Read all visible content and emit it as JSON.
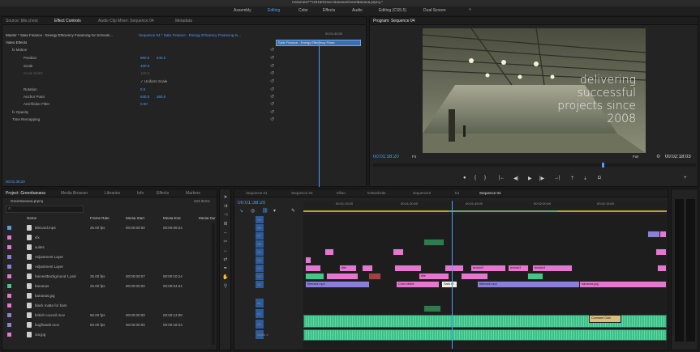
{
  "window": {
    "title": "/Volumes/***/2015/Green Banana/GreenBanana.prproj *"
  },
  "workspaces": [
    "Assembly",
    "Editing",
    "Color",
    "Effects",
    "Audio",
    "Editing (CS5.5)",
    "Dual Screen"
  ],
  "workspace_more": "»",
  "top_left_panel": {
    "tabs": [
      "Source: title.chest",
      "Effect Controls",
      "Audio Clip Mixer: Sequence 04",
      "Metadata"
    ],
    "breadcrumb_master": "Master * Salix Finance - Energy Efficiency Financing for Schools...",
    "breadcrumb_sequence": "Sequence 04 * Salix Finance - Energy Efficiency Financing fo...",
    "timecode": "00:01:40:00",
    "clip_label": "Salix Finance - Energy Efficiency Finan",
    "section_video": "Video Effects",
    "rows": [
      {
        "label": "fx Motion",
        "indent": 1,
        "value": "",
        "value2": ""
      },
      {
        "label": "Position",
        "indent": 3,
        "value": "960.0",
        "value2": "540.0"
      },
      {
        "label": "Scale",
        "indent": 2,
        "value": "100.0",
        "value2": ""
      },
      {
        "label": "Scale Width",
        "indent": 2,
        "value": "100.0",
        "value2": ""
      },
      {
        "label": "✓ Uniform Scale",
        "indent": 6,
        "value": "",
        "value2": ""
      },
      {
        "label": "Rotation",
        "indent": 2,
        "value": "0.0",
        "value2": ""
      },
      {
        "label": "Anchor Point",
        "indent": 3,
        "value": "640.0",
        "value2": "360.0"
      },
      {
        "label": "Anti-flicker Filter",
        "indent": 2,
        "value": "0.00",
        "value2": ""
      },
      {
        "label": "fx Opacity",
        "indent": 1,
        "value": "",
        "value2": ""
      },
      {
        "label": "Time Remapping",
        "indent": 1,
        "value": "",
        "value2": ""
      }
    ],
    "footer_time": "00:01:38:20"
  },
  "program": {
    "tab": "Program: Sequence 04",
    "overlay_lines": [
      "delivering",
      "successful",
      "projects since",
      "2008"
    ],
    "current_time": "00:01:38:20",
    "fit": "Fit",
    "quality": "Full",
    "duration": "00:02:18:03"
  },
  "project": {
    "tabs": [
      "Project: Greenbanana",
      "Media Browser",
      "Libraries",
      "Info",
      "Effects",
      "Markers"
    ],
    "filename": "Greenbanana.prproj",
    "item_count": "223 Items",
    "columns": [
      "Name",
      "Frame Rate",
      "Media Start",
      "Media End",
      "Media Dur"
    ],
    "items": [
      {
        "name": "titlecard.mp4",
        "rate": "25.00 fps",
        "start": "00:00:00:00",
        "end": "00:00:09:24",
        "color": "#4fa0e0"
      },
      {
        "name": "sfx",
        "rate": "",
        "start": "",
        "end": "",
        "color": "#e576d2"
      },
      {
        "name": "suites",
        "rate": "",
        "start": "",
        "end": "",
        "color": "#e576d2"
      },
      {
        "name": "Adjustment Layer",
        "rate": "",
        "start": "",
        "end": "",
        "color": "#8b7fd8"
      },
      {
        "name": "Adjustment Layer",
        "rate": "",
        "start": "",
        "end": "",
        "color": "#8b7fd8"
      },
      {
        "name": "harvestbackground 1.psd",
        "rate": "25.00 fps",
        "start": "00:00:00:07",
        "end": "00:00:10:14",
        "color": "#e576d2"
      },
      {
        "name": "bananas",
        "rate": "25.00 fps",
        "start": "00:00:00:00",
        "end": "00:00:04:24",
        "color": "#45c586"
      },
      {
        "name": "bananas.jpg",
        "rate": "",
        "start": "",
        "end": "",
        "color": "#e576d2"
      },
      {
        "name": "black matte for bars",
        "rate": "",
        "start": "",
        "end": "",
        "color": "#e576d2"
      },
      {
        "name": "british council.mov",
        "rate": "50.00 fps",
        "start": "00:00:00:00",
        "end": "00:00:13:08",
        "color": "#8b7fd8"
      },
      {
        "name": "bugfixweb.mov",
        "rate": "50.00 fps",
        "start": "00:00:00:00",
        "end": "00:00:18:23",
        "color": "#8b7fd8"
      },
      {
        "name": "cta.jpg",
        "rate": "",
        "start": "",
        "end": "",
        "color": "#e576d2"
      }
    ]
  },
  "timeline": {
    "tabs": [
      "Sequence 01",
      "Sequence 02",
      "Ellwo",
      "testwebsite",
      "sequence3",
      "tot",
      "Sequence 04"
    ],
    "timecode": "00:01:38:20",
    "ruler": [
      "00:01:15:00",
      "00:01:30:00",
      "00:01:45:00",
      "00:02:00:00",
      "00:02:15:00"
    ],
    "video_tracks": [
      "V9",
      "V8",
      "V7",
      "V6",
      "V5",
      "V4",
      "V3",
      "V2",
      "V1"
    ],
    "audio_tracks": [
      "A1",
      "A2",
      "A3",
      "Audio 4"
    ],
    "clips": {
      "c1": "title",
      "c2": "title",
      "c3": "Color Matte",
      "c4": "Salix Fi",
      "c5": "titlecard.mp4",
      "c6": "titlecard.mp4",
      "c7": "bananas.jpg",
      "c8": "textole2",
      "c9": "textole3",
      "c10": "textole3",
      "c11": "Constant Gain"
    }
  }
}
